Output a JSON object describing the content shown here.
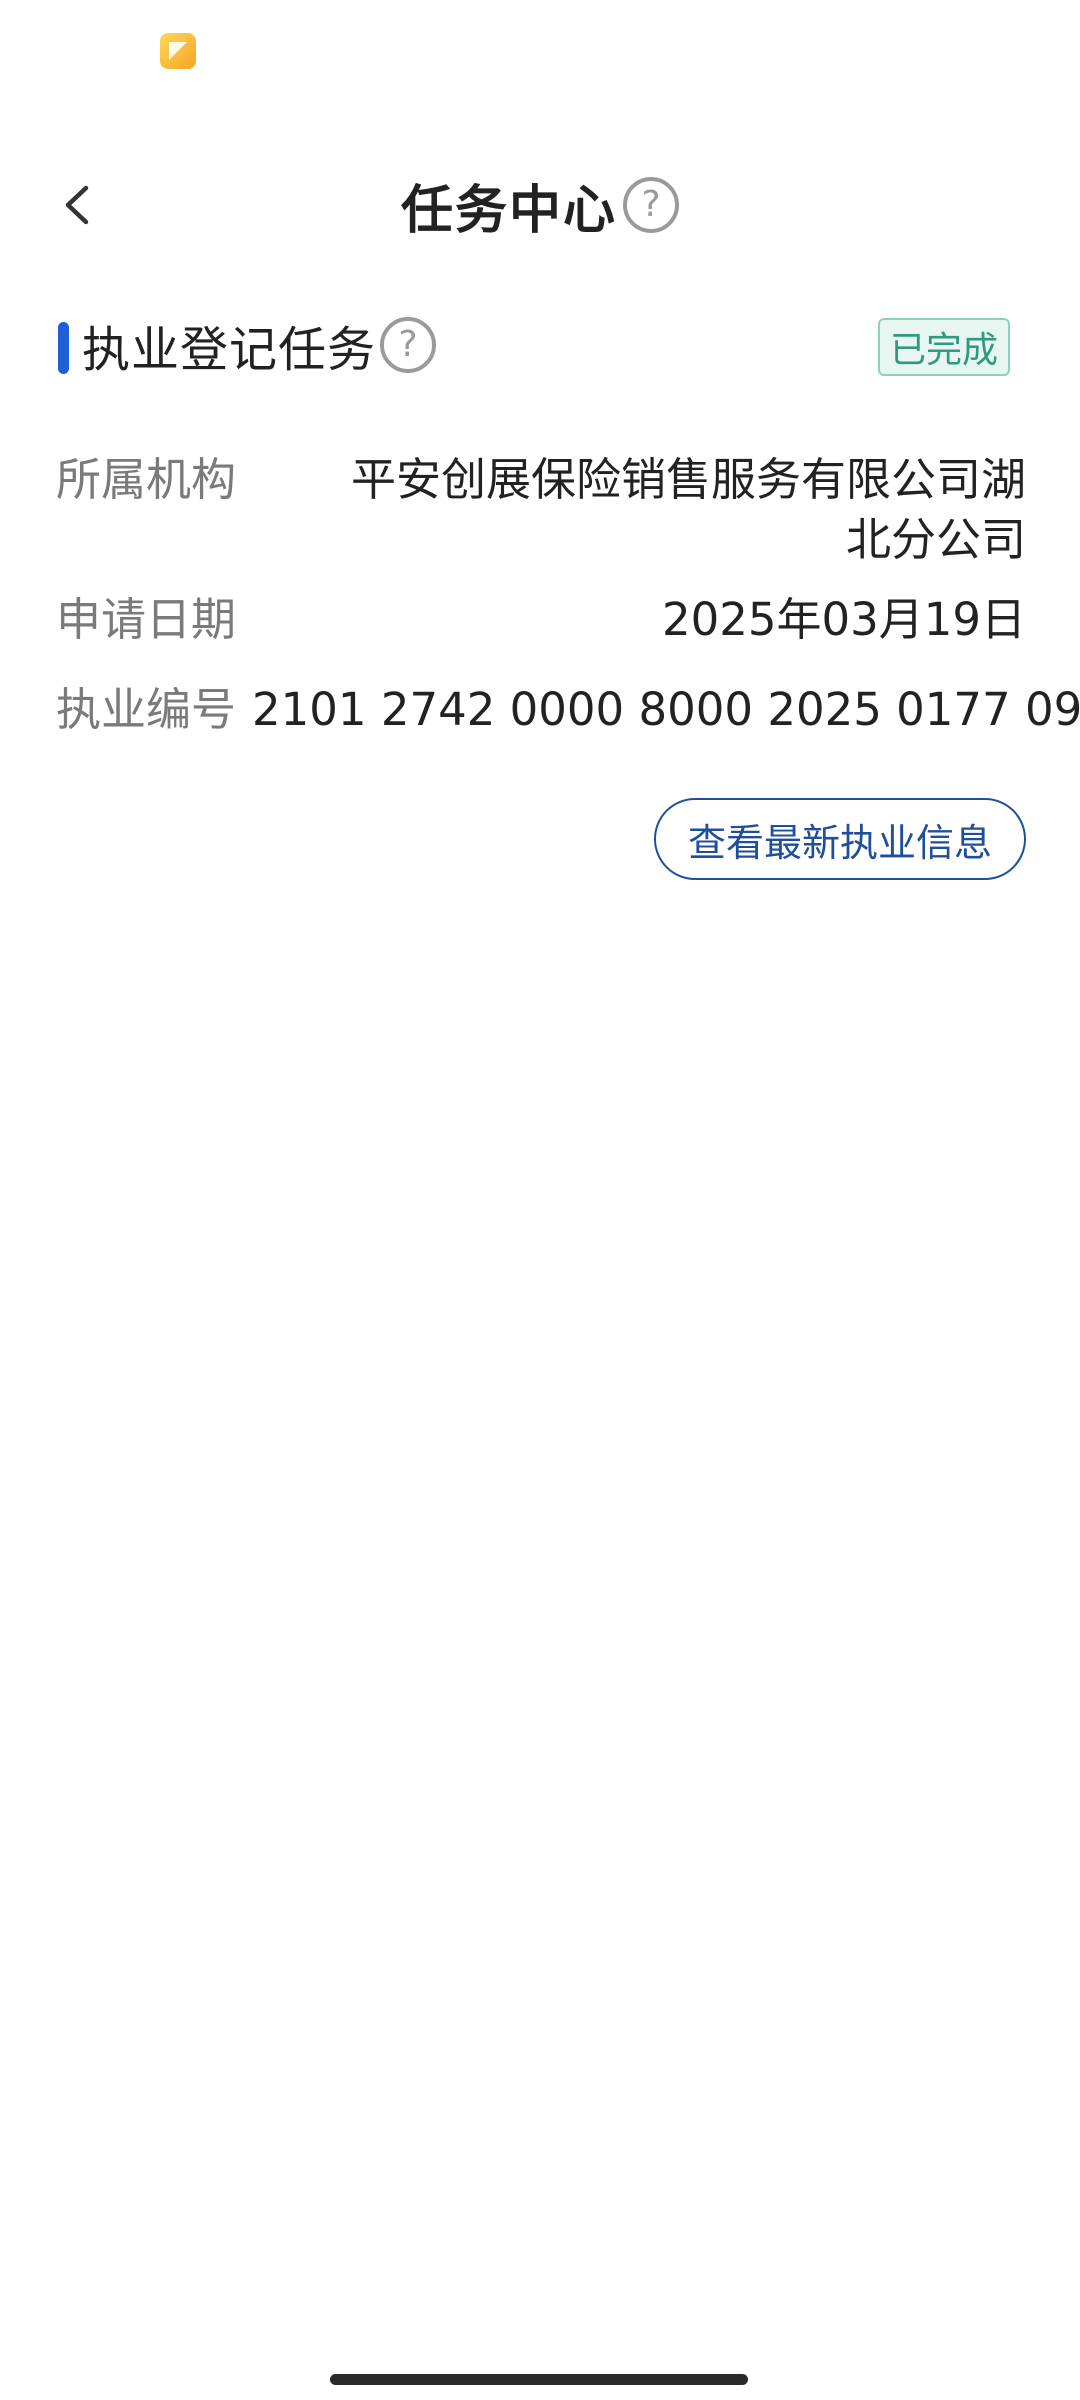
{
  "status_bar": {
    "notification_icon": "app-notification-icon"
  },
  "header": {
    "back_icon": "chevron-left-icon",
    "title": "任务中心",
    "help_icon_glyph": "?"
  },
  "task": {
    "title": "执业登记任务",
    "help_icon_glyph": "?",
    "status": "已完成",
    "accent_color": "#1f5fd6",
    "status_color": "#2f9a7e",
    "fields": {
      "org_label": "所属机构",
      "org_value": "平安创展保险销售服务有限公司湖北分公司",
      "date_label": "申请日期",
      "date_value": "2025年03月19日",
      "number_label": "执业编号",
      "number_value": "2101 2742 0000 8000 2025 0177 09"
    },
    "action_label": "查看最新执业信息"
  }
}
